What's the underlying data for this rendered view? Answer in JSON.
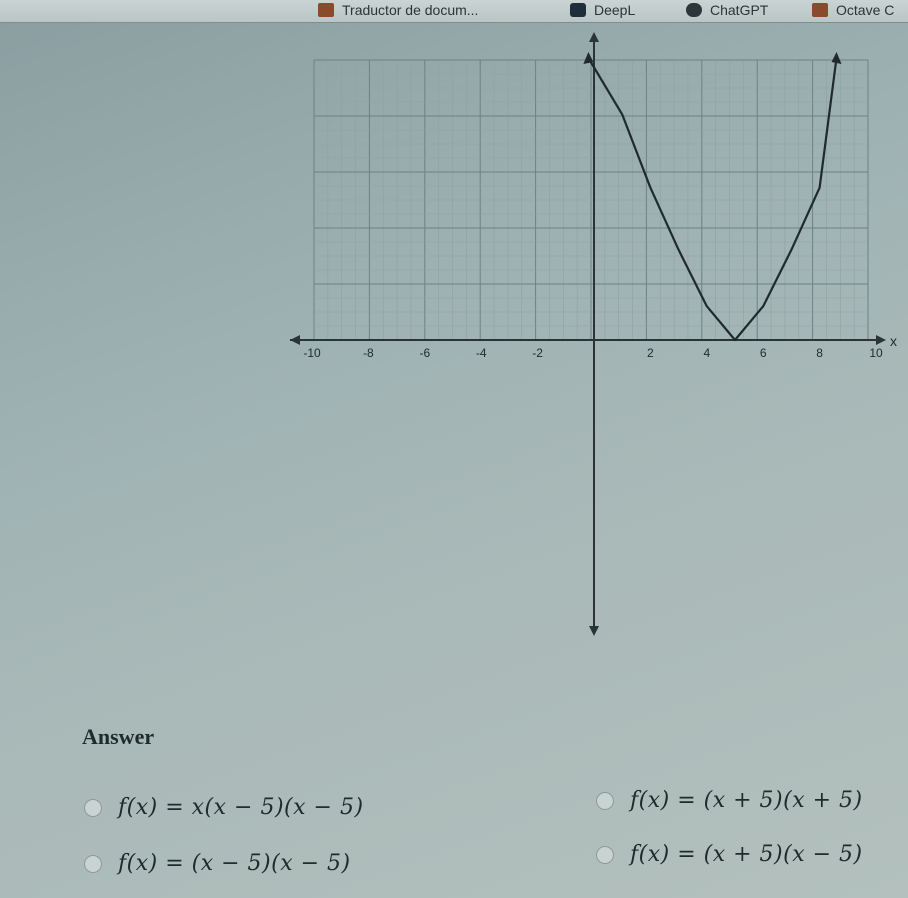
{
  "bookmarks": [
    {
      "label": "Traductor de docum...",
      "icon": "translate-icon"
    },
    {
      "label": "DeepL",
      "icon": "deepl-icon"
    },
    {
      "label": "ChatGPT",
      "icon": "chatgpt-icon"
    },
    {
      "label": "Octave C",
      "icon": "octave-icon"
    }
  ],
  "chart_data": {
    "type": "line",
    "xlabel": "x",
    "ylabel": "",
    "xlim": [
      -10,
      10
    ],
    "ylim": [
      -10,
      10
    ],
    "x_tick_labels": [
      "-10",
      "-8",
      "-6",
      "-4",
      "-2",
      "2",
      "4",
      "6",
      "8",
      "10"
    ],
    "grid": true,
    "series": [
      {
        "x": [
          -0.2,
          1,
          2,
          3,
          4,
          5,
          6,
          7,
          8,
          8.6
        ],
        "y": [
          10,
          8.0,
          5.4,
          3.2,
          1.2,
          0,
          1.2,
          3.2,
          5.4,
          10
        ],
        "description_points": "parabola with vertex at (5,0)"
      }
    ]
  },
  "answer": {
    "title": "Answer",
    "options": [
      {
        "text": "f(x) = x(x − 5)(x − 5)"
      },
      {
        "text": "f(x) = (x + 5)(x + 5)"
      },
      {
        "text": "f(x) = (x − 5)(x − 5)"
      },
      {
        "text": "f(x) = (x + 5)(x − 5)"
      }
    ]
  }
}
